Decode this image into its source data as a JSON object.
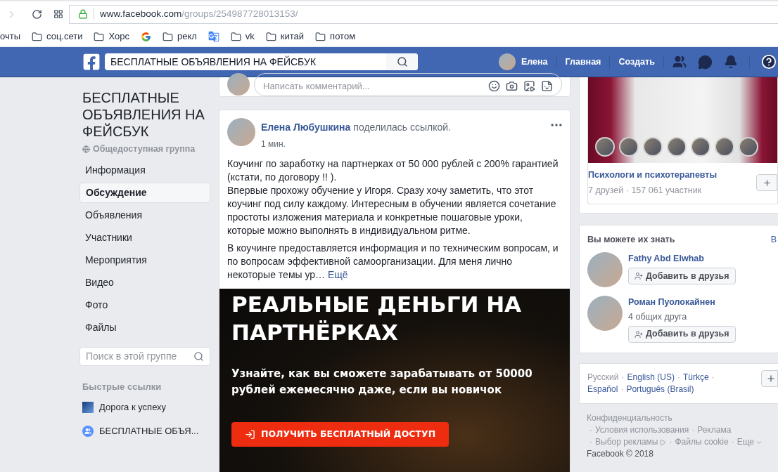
{
  "browser": {
    "url_host": "www.facebook.com",
    "url_path": "/groups/254987728013153/",
    "bookmarks": [
      {
        "label": "очты",
        "kind": "text"
      },
      {
        "label": "соц.сети",
        "kind": "folder"
      },
      {
        "label": "Хорс",
        "kind": "folder"
      },
      {
        "kind": "google"
      },
      {
        "label": "рекл",
        "kind": "folder"
      },
      {
        "kind": "translate"
      },
      {
        "label": "vk",
        "kind": "folder"
      },
      {
        "label": "китай",
        "kind": "folder"
      },
      {
        "label": "потом",
        "kind": "folder"
      }
    ]
  },
  "topbar": {
    "search_value": "БЕСПЛАТНЫЕ ОБЪЯВЛЕНИЯ НА ФЕЙСБУК",
    "user": "Елена",
    "links": [
      "Главная",
      "Создать"
    ]
  },
  "sidebar": {
    "group_title": "БЕСПЛАТНЫЕ ОБЪЯВЛЕНИЯ НА ФЕЙСБУК",
    "privacy": "Общедоступная группа",
    "items": [
      {
        "label": "Информация",
        "selected": false
      },
      {
        "label": "Обсуждение",
        "selected": true
      },
      {
        "label": "Объявления",
        "selected": false
      },
      {
        "label": "Участники",
        "selected": false
      },
      {
        "label": "Мероприятия",
        "selected": false
      },
      {
        "label": "Видео",
        "selected": false
      },
      {
        "label": "Фото",
        "selected": false
      },
      {
        "label": "Файлы",
        "selected": false
      }
    ],
    "search_placeholder": "Поиск в этой группе",
    "shortcuts_title": "Быстрые ссылки",
    "shortcuts": [
      {
        "label": "Дорога к успеху",
        "kind": "image"
      },
      {
        "label": "БЕСПЛАТНЫЕ ОБЪЯ...",
        "kind": "group"
      }
    ]
  },
  "comment": {
    "placeholder": "Написать комментарий..."
  },
  "post": {
    "author": "Елена Любушкина",
    "action": "поделилась ссылкой.",
    "time": "1 мин.",
    "paragraphs": [
      [
        "Коучинг по заработку на партнерках от 50 000 рублей с 200% гарантией (кстати, по договору !! ).",
        "Впервые прохожу обучение у Игоря. Сразу хочу заметить, что этот коучинг под силу каждому. Интересным в обучении является сочетание простоты изложения материала и конкретные пошаговые уроки, которые можно выполнять в индивидуальном ритме."
      ],
      [
        "В коучинге предоставляется информация и по техническим вопросам, и по вопросам эффективной самоорганизации. Для меня лично некоторые темы ур…"
      ]
    ],
    "more": "Ещё",
    "banner": {
      "headline": "РЕАЛЬНЫЕ ДЕНЬГИ НА ПАРТНЁРКАХ",
      "subtitle": "Узнайте, как вы сможете зарабатывать от 50000 рублей ежемесячно даже, если вы новичок",
      "button": "ПОЛУЧИТЬ БЕСПЛАТНЫЙ ДОСТУП"
    }
  },
  "suggested_group": {
    "name": "Психологи и психотерапевты",
    "meta": "7 друзей · 157 061 участник"
  },
  "people": {
    "title": "Вы можете их знать",
    "see_all": "В",
    "items": [
      {
        "name": "Fathy Abd Elwhab",
        "button": "Добавить в друзья"
      },
      {
        "name": "Роман Пуолокайнен",
        "mutual": "4 общих друга",
        "button": "Добавить в друзья"
      }
    ]
  },
  "languages": {
    "separator": "·",
    "items": [
      {
        "label": "Русский",
        "selected": true
      },
      {
        "label": "English (US)",
        "selected": false
      },
      {
        "label": "Türkçe",
        "selected": false
      },
      {
        "label": "Español",
        "selected": false
      },
      {
        "label": "Português (Brasil)",
        "selected": false
      }
    ]
  },
  "footer": {
    "separator": "·",
    "links": [
      {
        "label": "Конфиденциальность",
        "kind": "text"
      },
      {
        "label": "Условия использования",
        "kind": "text"
      },
      {
        "label": "Реклама",
        "kind": "text"
      },
      {
        "label": "Выбор рекламы",
        "kind": "adchoices"
      },
      {
        "label": "Файлы cookie",
        "kind": "text"
      },
      {
        "label": "Еще",
        "kind": "menu"
      }
    ],
    "copyright": "Facebook © 2018"
  }
}
